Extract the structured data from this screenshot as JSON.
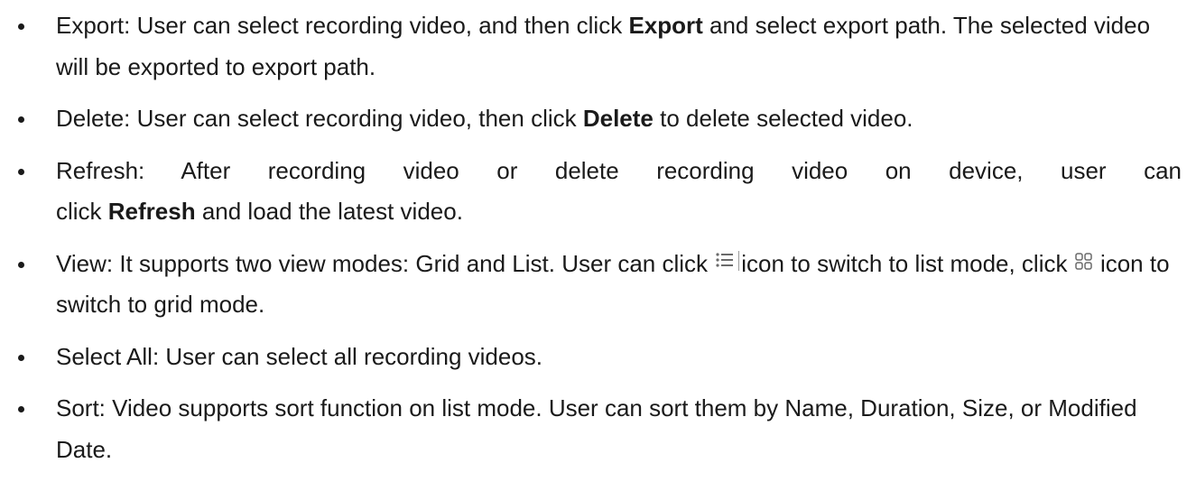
{
  "items": [
    {
      "label": "Export:",
      "pre": " User can select recording video, and then click ",
      "bold": "Export",
      "post": " and select export path. The selected video will be exported to export path."
    },
    {
      "label": "Delete:",
      "pre": " User can select recording video, then click ",
      "bold": "Delete",
      "post": " to delete selected video."
    },
    {
      "label": "Refresh:",
      "line1": " After recording video or delete recording video on device, user can",
      "pre": "click ",
      "bold": "Refresh",
      "post": " and load the latest video."
    },
    {
      "label": "View:",
      "pre": " It supports two view modes: Grid and List. User can click ",
      "mid": "icon to switch to list mode, click ",
      "post": " icon to switch to grid mode.",
      "list_icon": "list-view-icon",
      "grid_icon": "grid-view-icon"
    },
    {
      "label": "Select All:",
      "pre": " User can select all recording videos."
    },
    {
      "label": "Sort:",
      "pre": " Video supports sort function on list mode. User can sort them by Name, Duration, Size, or Modified Date."
    }
  ],
  "colors": {
    "text": "#1a1a1a",
    "icon": "#5a5a5a"
  }
}
